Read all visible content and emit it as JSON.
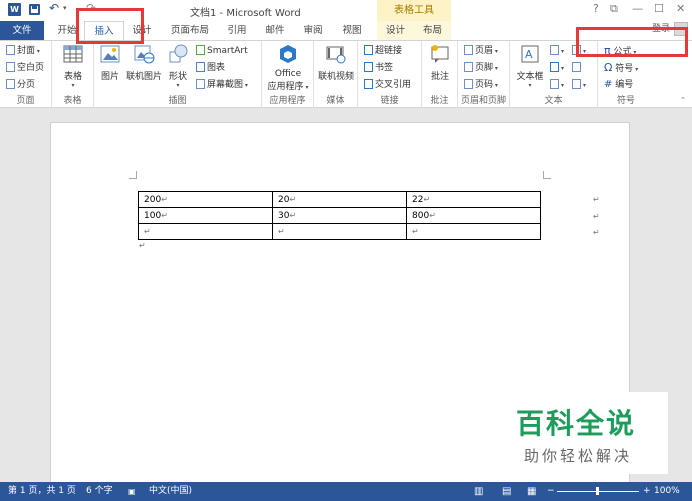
{
  "window": {
    "title": "文档1 - Microsoft Word",
    "context_group": "表格工具",
    "help": "?",
    "ribbon_opts": "⧉",
    "minimize": "—",
    "maximize": "☐",
    "close": "✕"
  },
  "qat": {
    "app_icon": "W",
    "undo": "↶",
    "undo_more": "▾",
    "redo": "↷"
  },
  "tabs": {
    "file": "文件",
    "home": "开始",
    "insert": "插入",
    "design": "设计",
    "layout": "页面布局",
    "references": "引用",
    "mailings": "邮件",
    "review": "审阅",
    "view": "视图",
    "ctx_design": "设计",
    "ctx_layout": "布局"
  },
  "account": {
    "login": "登录"
  },
  "ribbon": {
    "pages": {
      "cover": "封面",
      "blank": "空白页",
      "break": "分页",
      "label": "页面"
    },
    "tables": {
      "table": "表格",
      "label": "表格"
    },
    "illustrations": {
      "picture": "图片",
      "online_picture": "联机图片",
      "shapes": "形状",
      "smartart": "SmartArt",
      "chart": "图表",
      "screenshot": "屏幕截图",
      "label": "插图"
    },
    "apps": {
      "office": "Office",
      "apps": "应用程序",
      "label": "应用程序"
    },
    "media": {
      "online_video": "联机视频",
      "label": "媒体"
    },
    "links": {
      "hyperlink": "超链接",
      "bookmark": "书签",
      "crossref": "交叉引用",
      "label": "链接"
    },
    "comments": {
      "comment": "批注",
      "label": "批注"
    },
    "header_footer": {
      "header": "页眉",
      "footer": "页脚",
      "page_number": "页码",
      "label": "页眉和页脚"
    },
    "text": {
      "textbox": "文本框",
      "label": "文本"
    },
    "symbols": {
      "equation_icon": "π",
      "equation": "公式",
      "symbol_icon": "Ω",
      "symbol": "符号",
      "number_icon": "#",
      "number": "编号",
      "label": "符号"
    }
  },
  "table": {
    "rows": [
      [
        "200",
        "20",
        "22"
      ],
      [
        "100",
        "30",
        "800"
      ],
      [
        "",
        "",
        ""
      ]
    ]
  },
  "status": {
    "page": "第 1 页，共 1 页",
    "words": "6 个字",
    "language": "中文(中国)",
    "zoom_minus": "−",
    "zoom_plus": "+",
    "zoom": "100%"
  },
  "watermark": {
    "line1": "百科全说",
    "line2": "助你轻松解决"
  },
  "colors": {
    "accent": "#2b579a",
    "context": "#fdf3c6",
    "highlight": "#e53935",
    "watermark": "#1e9c5c"
  }
}
